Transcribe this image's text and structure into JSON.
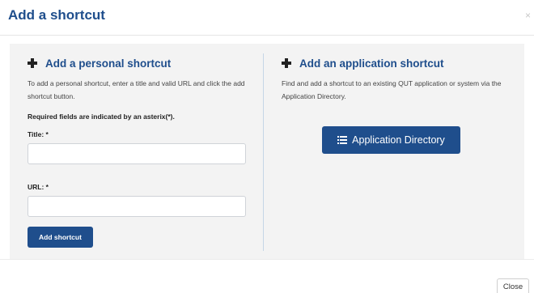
{
  "dialog": {
    "title": "Add a shortcut",
    "close_x": "×"
  },
  "personal": {
    "heading": "Add a personal shortcut",
    "description": "To add a personal shortcut, enter a title and valid URL and click the add shortcut button.",
    "required_note": "Required fields are indicated by an asterix(*).",
    "title_label": "Title: *",
    "title_value": "",
    "url_label": "URL: *",
    "url_value": "",
    "submit_label": "Add shortcut"
  },
  "application": {
    "heading": "Add an application shortcut",
    "description": "Find and add a shortcut to an existing QUT application or system via the Application Directory.",
    "directory_button": "Application Directory"
  },
  "footer": {
    "close_label": "Close"
  },
  "colors": {
    "primary": "#1f4e8c",
    "panel_bg": "#f3f3f3",
    "divider": "#c5d6e6"
  }
}
